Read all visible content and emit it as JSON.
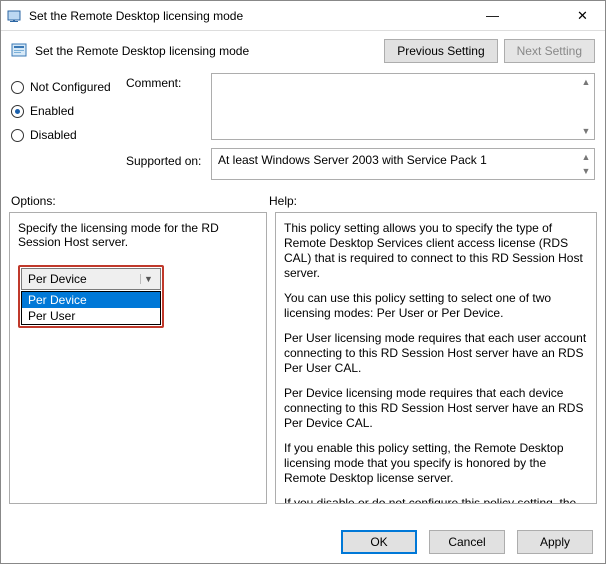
{
  "window": {
    "title": "Set the Remote Desktop licensing mode",
    "minimize": "—",
    "close": "✕"
  },
  "header": {
    "subtitle": "Set the Remote Desktop licensing mode",
    "previous_btn": "Previous Setting",
    "next_btn": "Next Setting"
  },
  "config": {
    "not_configured": "Not Configured",
    "enabled": "Enabled",
    "disabled": "Disabled",
    "selected": "enabled",
    "comment_label": "Comment:",
    "supported_label": "Supported on:",
    "supported_value": "At least Windows Server 2003 with Service Pack 1"
  },
  "sections": {
    "options_label": "Options:",
    "help_label": "Help:"
  },
  "options": {
    "specify_text": "Specify the licensing mode for the RD Session Host server.",
    "dropdown_selected": "Per Device",
    "dropdown_items": [
      "Per Device",
      "Per User"
    ]
  },
  "help": {
    "p1": "This policy setting allows you to specify the type of Remote Desktop Services client access license (RDS CAL) that is required to connect to this RD Session Host server.",
    "p2": "You can use this policy setting to select one of two licensing modes: Per User or Per Device.",
    "p3": "Per User licensing mode requires that each user account connecting to this RD Session Host server have an RDS Per User CAL.",
    "p4": "Per Device licensing mode requires that each device connecting to this RD Session Host server have an RDS Per Device CAL.",
    "p5": "If you enable this policy setting, the Remote Desktop licensing mode that you specify is honored by the Remote Desktop license server.",
    "p6": "If you disable or do not configure this policy setting, the licensing mode is not specified at the Group Policy level."
  },
  "footer": {
    "ok": "OK",
    "cancel": "Cancel",
    "apply": "Apply"
  }
}
